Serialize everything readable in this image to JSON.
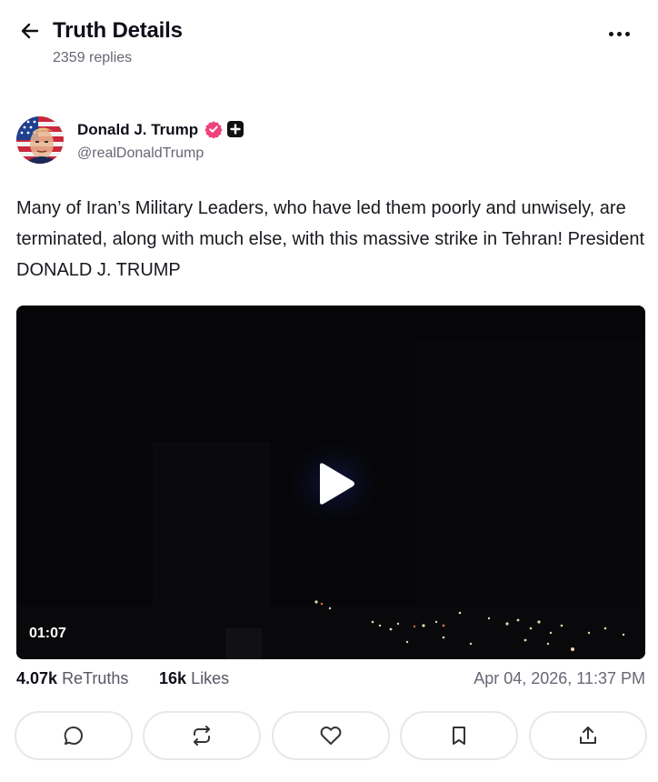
{
  "header": {
    "title": "Truth Details",
    "replies": "2359 replies"
  },
  "author": {
    "name": "Donald J. Trump",
    "handle": "@realDonaldTrump"
  },
  "post": {
    "text": "Many of Iran’s Military Leaders, who have led them poorly and unwisely, are terminated, along with much else, with this massive strike in Tehran! President DONALD J. TRUMP"
  },
  "video": {
    "duration": "01:07"
  },
  "stats": {
    "retruths_count": "4.07k",
    "retruths_label": "ReTruths",
    "likes_count": "16k",
    "likes_label": "Likes",
    "timestamp": "Apr 04, 2026, 11:37 PM"
  },
  "actions": [
    {
      "icon": "reply-icon"
    },
    {
      "icon": "retruth-icon"
    },
    {
      "icon": "like-icon"
    },
    {
      "icon": "bookmark-icon"
    },
    {
      "icon": "share-icon"
    }
  ],
  "colors": {
    "verified_badge": "#f0427a",
    "muted_text": "#666874",
    "button_border": "#e7e7ec"
  }
}
